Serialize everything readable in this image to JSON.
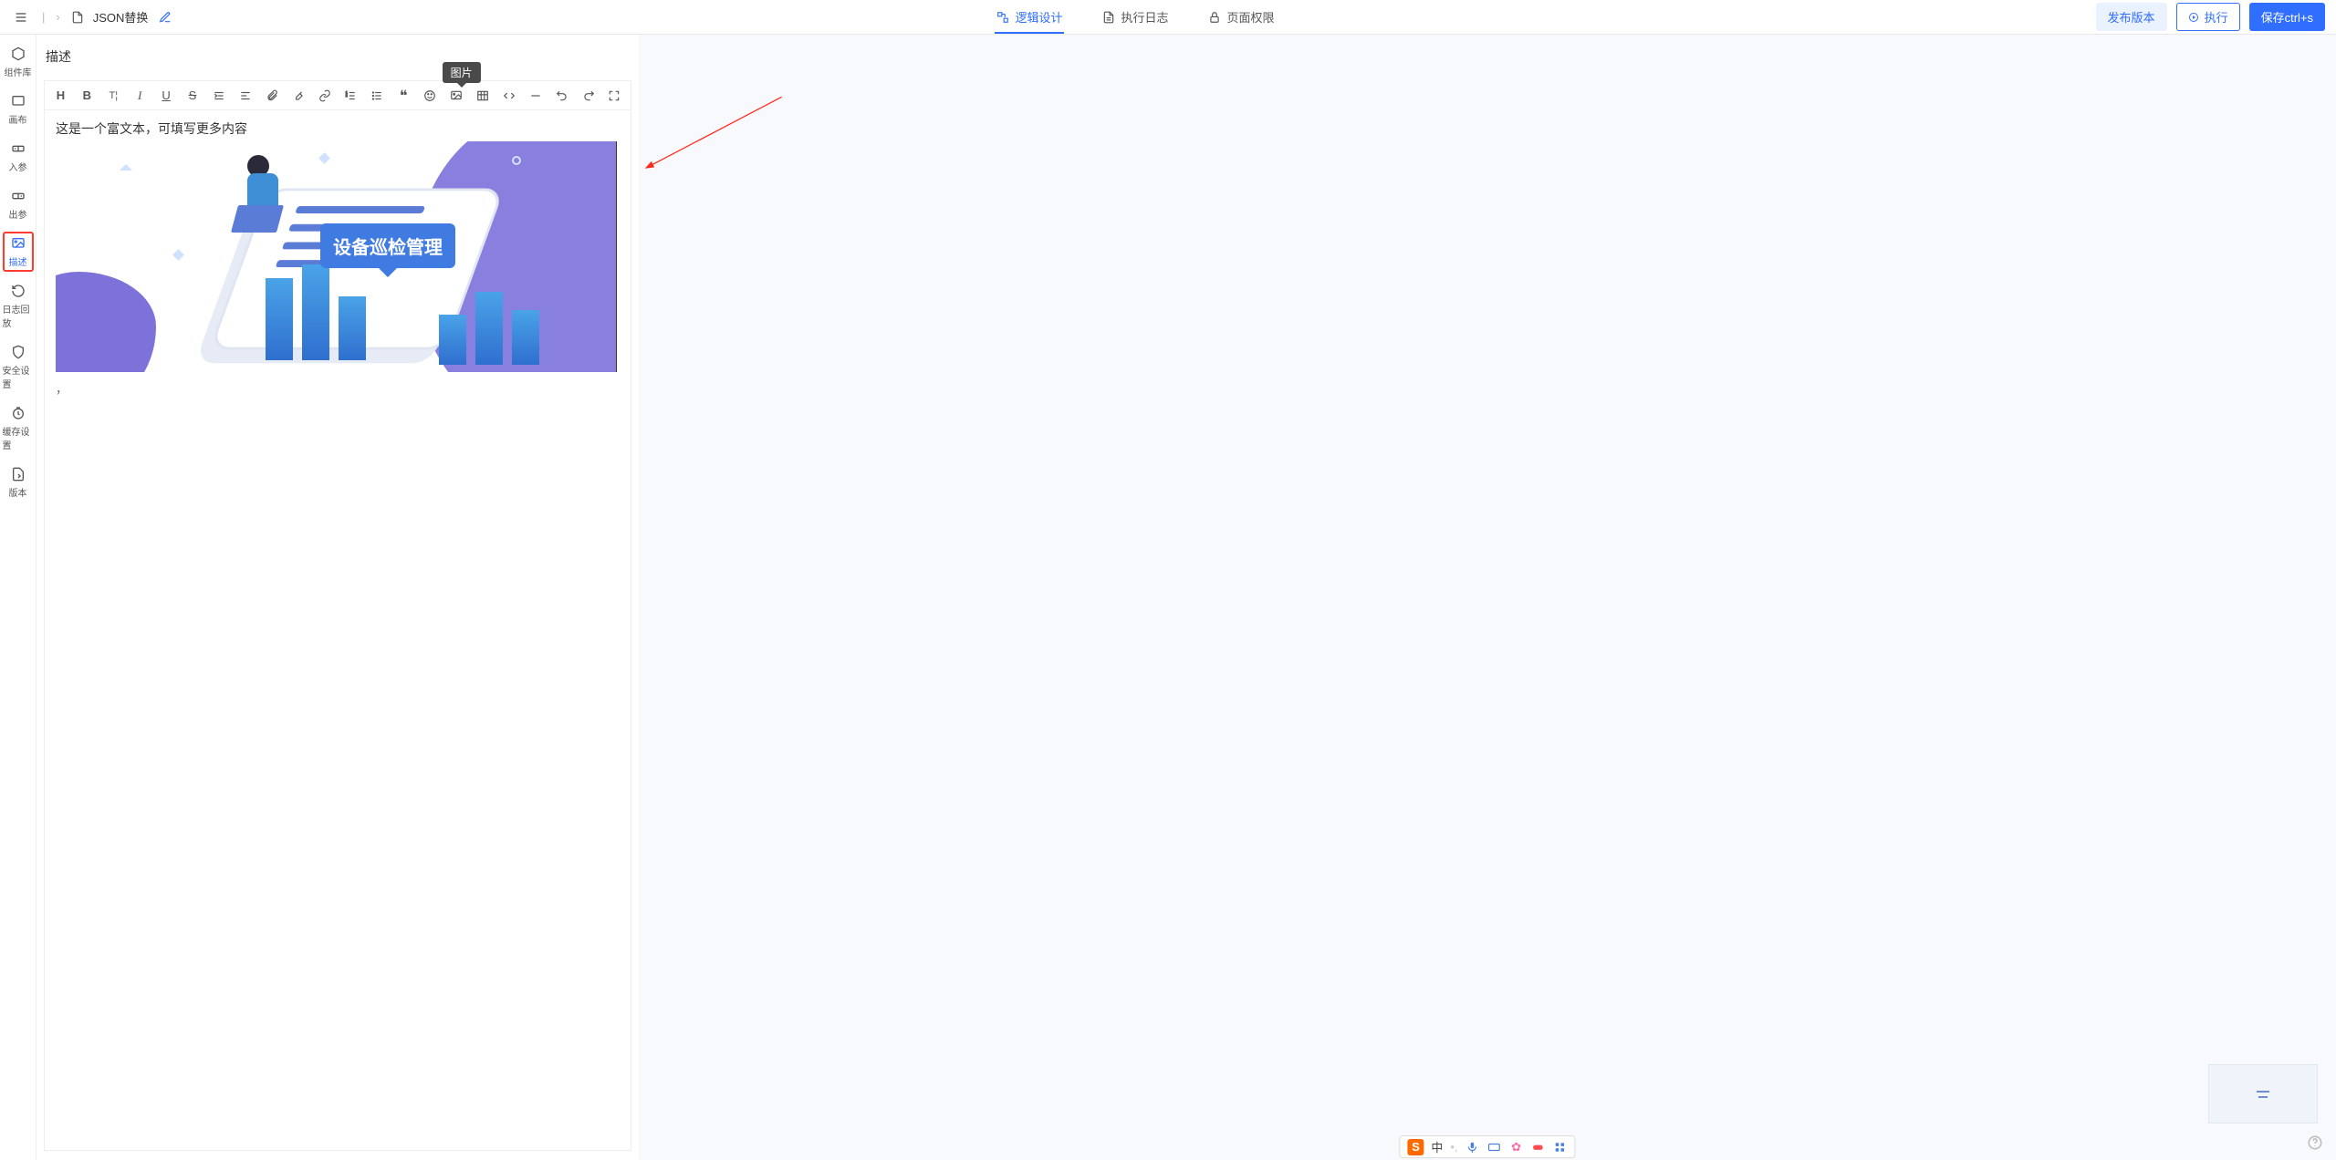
{
  "breadcrumb": {
    "file_name": "JSON替换"
  },
  "top_tabs": {
    "logic": "逻辑设计",
    "logs": "执行日志",
    "perm": "页面权限"
  },
  "actions": {
    "publish": "发布版本",
    "run": "执行",
    "save": "保存ctrl+s"
  },
  "sidebar": {
    "items": [
      {
        "key": "components",
        "label": "组件库"
      },
      {
        "key": "canvas",
        "label": "画布"
      },
      {
        "key": "input",
        "label": "入参"
      },
      {
        "key": "output",
        "label": "出参"
      },
      {
        "key": "desc",
        "label": "描述"
      },
      {
        "key": "replay",
        "label": "日志回放"
      },
      {
        "key": "security",
        "label": "安全设置"
      },
      {
        "key": "cache",
        "label": "缓存设置"
      },
      {
        "key": "version",
        "label": "版本"
      }
    ]
  },
  "panel": {
    "title": "描述",
    "tooltip_image": "图片",
    "editor_text": "这是一个富文本，可填写更多内容",
    "secondary_char": "，",
    "image_badge": "设备巡检管理"
  },
  "toolbar": {
    "items": [
      "heading",
      "bold",
      "formatTi",
      "italic",
      "underline",
      "strike",
      "indent",
      "align",
      "attachment",
      "highlight",
      "link",
      "list-ordered",
      "list-unordered",
      "quote",
      "emoji",
      "image",
      "table",
      "divider",
      "hr",
      "undo",
      "redo",
      "fullscreen"
    ]
  },
  "ime": {
    "logo_letter": "S",
    "lang": "中"
  }
}
